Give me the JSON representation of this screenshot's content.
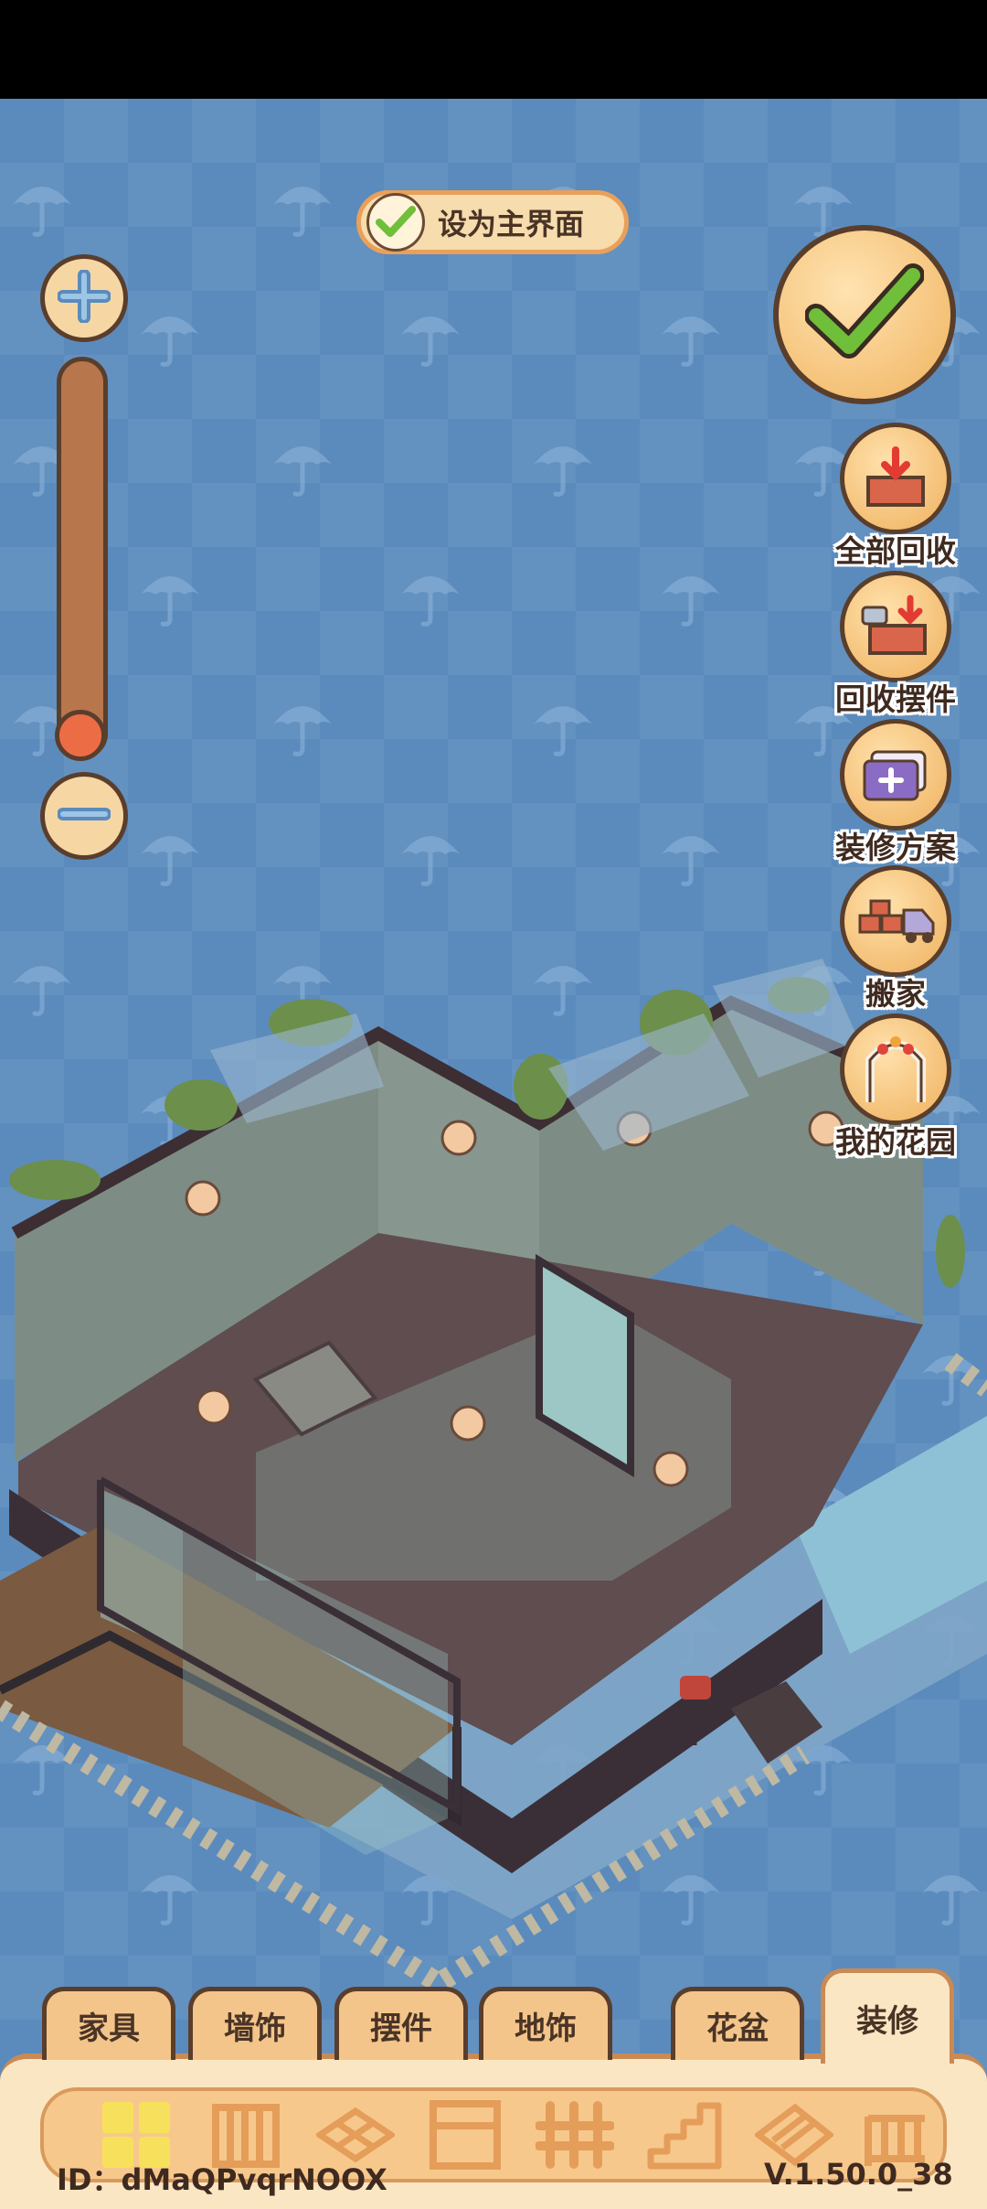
{
  "toggle": {
    "label": "设为主界面",
    "checked": true
  },
  "side_actions": [
    {
      "label": "全部回收",
      "icon": "box-recycle-icon"
    },
    {
      "label": "回收摆件",
      "icon": "ornament-recycle-icon"
    },
    {
      "label": "装修方案",
      "icon": "plan-add-icon"
    },
    {
      "label": "搬家",
      "icon": "moving-truck-icon"
    },
    {
      "label": "我的花园",
      "icon": "garden-arch-icon"
    }
  ],
  "tabs": [
    {
      "label": "家具",
      "active": false
    },
    {
      "label": "墙饰",
      "active": false
    },
    {
      "label": "摆件",
      "active": false
    },
    {
      "label": "地饰",
      "active": false
    },
    {
      "label": "花盆",
      "active": false
    },
    {
      "label": "装修",
      "active": true
    }
  ],
  "category_icons": [
    "grid-all-icon",
    "wall-panel-icon",
    "floor-tile-icon",
    "window-icon",
    "fence-icon",
    "stairs-icon",
    "roof-icon",
    "railing-icon"
  ],
  "footer": {
    "id": "ID：dMaQPvqrNOOX",
    "version": "V.1.50.0_38"
  },
  "colors": {
    "sky": "#5b8bbd",
    "ui_cream": "#fbe6c3",
    "ui_orange": "#f4c58a",
    "outline": "#5a3e2c",
    "check_green": "#6fbf3a"
  }
}
